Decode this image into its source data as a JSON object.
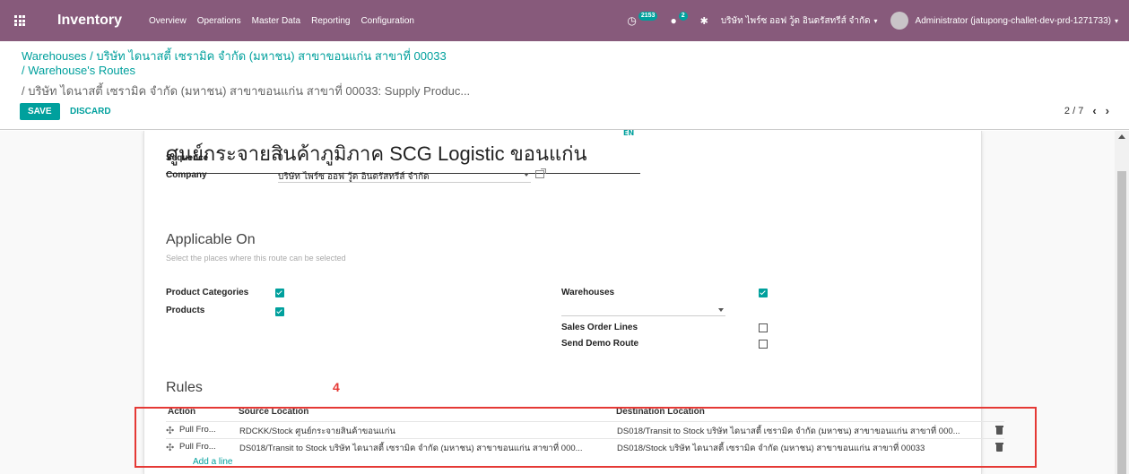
{
  "navbar": {
    "app_name": "Inventory",
    "menu": [
      "Overview",
      "Operations",
      "Master Data",
      "Reporting",
      "Configuration"
    ],
    "activity_count": "2153",
    "message_count": "2",
    "company": "บริษัท ไพร์ซ ออฟ วู้ด อินดรัสทรีส์ จำกัด",
    "user": "Administrator (jatupong-challet-dev-prd-1271733)"
  },
  "breadcrumb": {
    "part1_link": "Warehouses",
    "part1_sep": " / ",
    "part1_text": "บริษัท ไดนาสตี้ เซรามิค จำกัด (มหาชน) สาขาขอนแก่น สาขาที่ 00033",
    "part2": "/ Warehouse's Routes",
    "part3": "/ บริษัท ไดนาสตี้ เซรามิค จำกัด (มหาชน) สาขาขอนแก่น สาขาที่ 00033: Supply Produc..."
  },
  "actions": {
    "save": "SAVE",
    "discard": "DISCARD"
  },
  "pager": {
    "text": "2 / 7"
  },
  "form": {
    "title": "ศูนย์กระจายสินค้าภูมิภาค SCG Logistic ขอนแก่น",
    "lang": "EN",
    "sequence_label": "Sequence",
    "sequence_value": "0",
    "company_label": "Company",
    "company_value": "บริษัท ไพร์ซ ออฟ วู้ด อินดรัสทรีส์ จำกัด",
    "applicable_heading": "Applicable On",
    "applicable_hint": "Select the places where this route can be selected",
    "product_categories_label": "Product Categories",
    "products_label": "Products",
    "warehouses_label": "Warehouses",
    "sales_order_lines_label": "Sales Order Lines",
    "send_demo_route_label": "Send Demo Route",
    "product_categories_checked": true,
    "products_checked": true,
    "warehouses_checked": true,
    "sales_order_lines_checked": false,
    "send_demo_route_checked": false
  },
  "rules": {
    "heading": "Rules",
    "annotation": "4",
    "columns": [
      "Action",
      "Source Location",
      "Destination Location"
    ],
    "rows": [
      {
        "action": "Pull Fro...",
        "source": "RDCKK/Stock ศูนย์กระจายสินค้าขอนแก่น",
        "destination": "DS018/Transit to Stock บริษัท ไดนาสตี้ เซรามิค จำกัด (มหาชน) สาขาขอนแก่น สาขาที่ 000..."
      },
      {
        "action": "Pull Fro...",
        "source": "DS018/Transit to Stock บริษัท ไดนาสตี้ เซรามิค จำกัด (มหาชน) สาขาขอนแก่น สาขาที่ 000...",
        "destination": "DS018/Stock บริษัท ไดนาสตี้ เซรามิค จำกัด (มหาชน) สาขาขอนแก่น สาขาที่ 00033"
      }
    ],
    "add_line": "Add a line"
  }
}
